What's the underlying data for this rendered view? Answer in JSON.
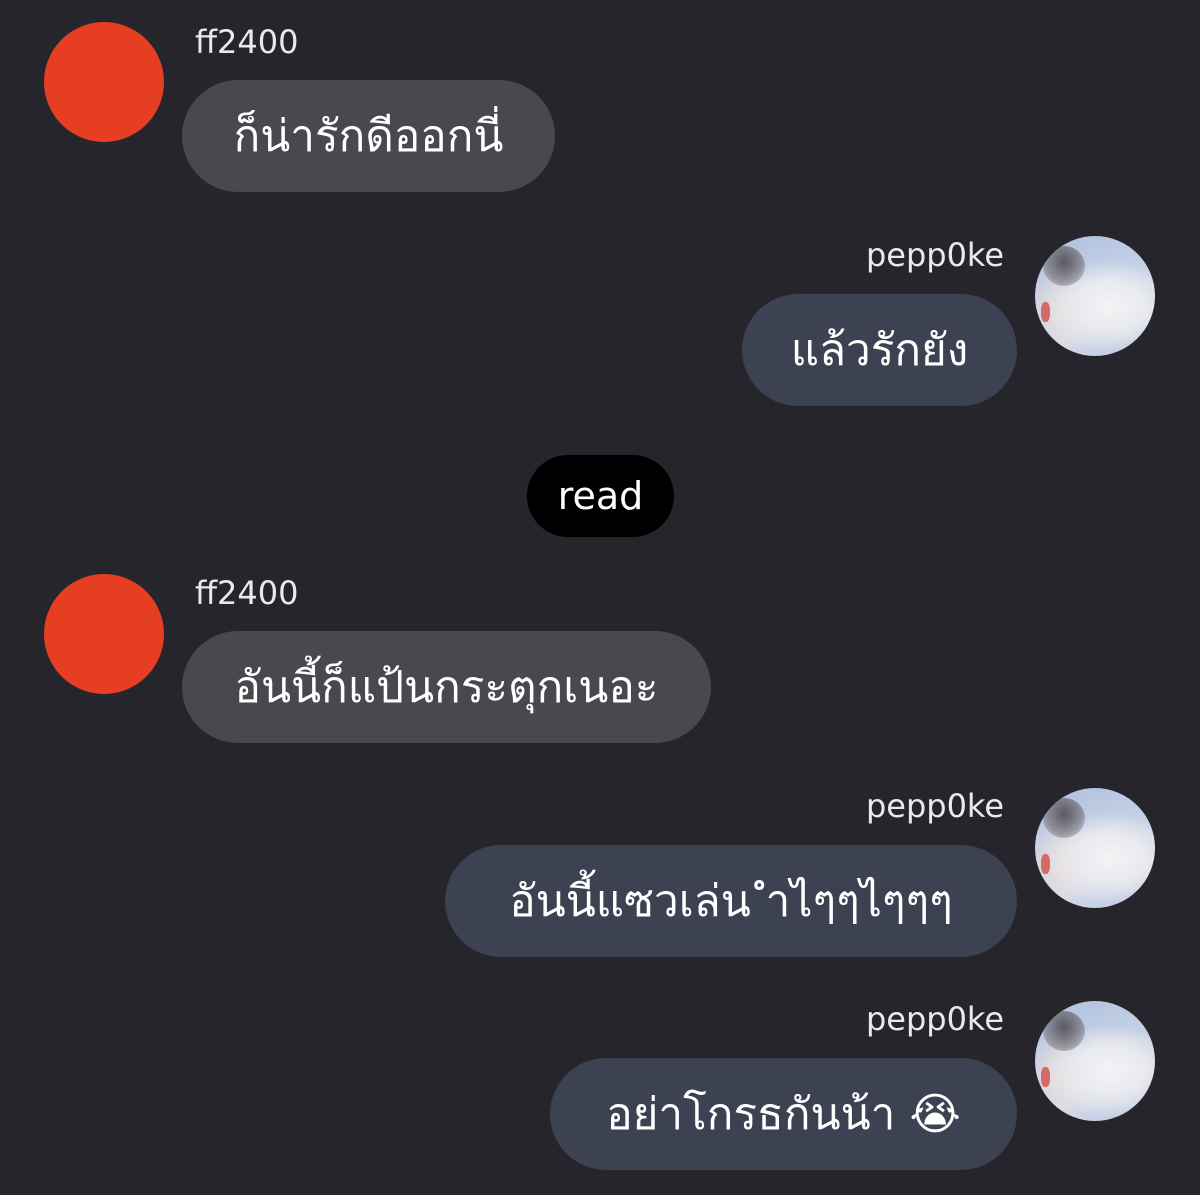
{
  "messages": [
    {
      "sender": "ff2400",
      "text": "ก็น่ารักดีออกนี่",
      "direction": "incoming"
    },
    {
      "sender": "pepp0ke",
      "text": "แล้วรักยัง",
      "direction": "outgoing"
    },
    {
      "sender": "ff2400",
      "text": "อันนี้ก็แป้นกระตุกเนอะ",
      "direction": "incoming"
    },
    {
      "sender": "pepp0ke",
      "text": "อันนี้แซวเล่น ำไๆๆไๆๆๆ",
      "direction": "outgoing"
    },
    {
      "sender": "pepp0ke",
      "text": "อย่าโกรธกันน้า 😭",
      "direction": "outgoing"
    }
  ],
  "read_status": "read",
  "colors": {
    "background": "#25252b",
    "incoming_bubble": "#48484e",
    "outgoing_bubble": "#3c4252",
    "avatar_red": "#e63e22",
    "read_pill": "#000000"
  },
  "icons": {
    "incoming_avatar": "red-circle-avatar",
    "outgoing_avatar": "photo-avatar"
  }
}
